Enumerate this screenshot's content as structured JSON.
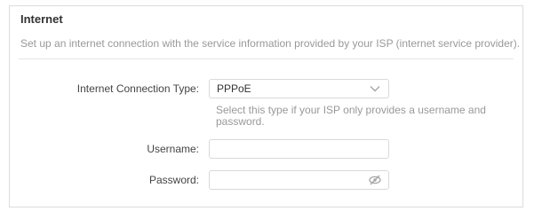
{
  "section": {
    "title": "Internet",
    "description": "Set up an internet connection with the service information provided by your ISP (internet service provider)."
  },
  "connection_type": {
    "label": "Internet Connection Type:",
    "selected": "PPPoE",
    "hint": "Select this type if your ISP only provides a username and password."
  },
  "username": {
    "label": "Username:",
    "value": "",
    "placeholder": ""
  },
  "password": {
    "label": "Password:",
    "value": "",
    "placeholder": "",
    "toggle_icon": "eye-slash-icon"
  },
  "colors": {
    "border": "#dcdcdc",
    "muted_text": "#999999",
    "text": "#333333"
  }
}
